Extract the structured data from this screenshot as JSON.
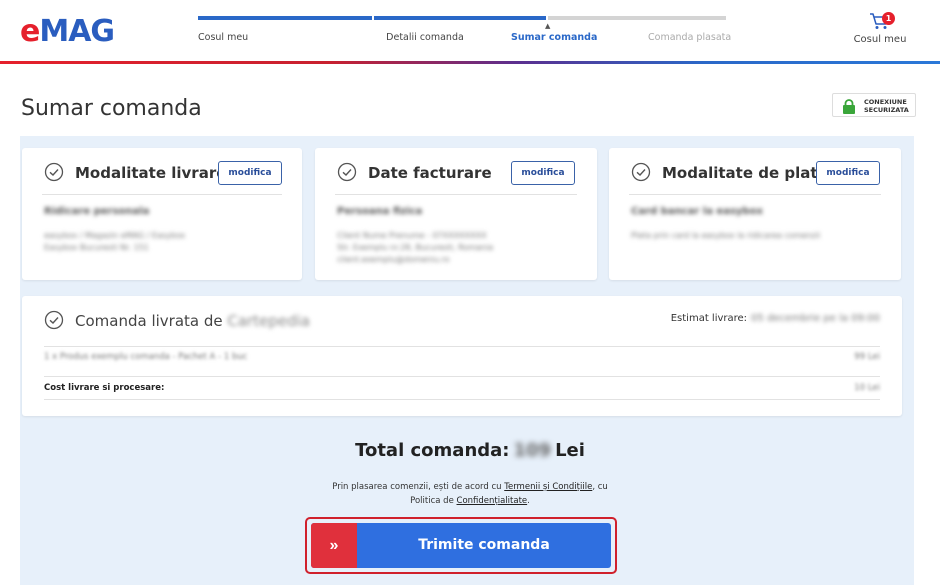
{
  "header": {
    "logo": {
      "e": "e",
      "mag": "MAG"
    },
    "steps": [
      {
        "label": "Cosul meu",
        "state": "done"
      },
      {
        "label": "Detalii comanda",
        "state": "done"
      },
      {
        "label": "Sumar comanda",
        "state": "active"
      },
      {
        "label": "Comanda plasata",
        "state": "todo"
      }
    ],
    "cart": {
      "label": "Cosul meu",
      "count": "1",
      "icon": "cart-icon"
    }
  },
  "page": {
    "title": "Sumar comanda",
    "secure_badge": {
      "line1": "CONEXIUNE",
      "line2": "SECURIZATA",
      "icon": "lock-icon"
    }
  },
  "cards": {
    "delivery_method": {
      "title": "Modalitate livrare",
      "button": "modifica",
      "line1": "Ridicare personala",
      "line2": "easybox / Magazin eMAG / Easybox",
      "line3": "Easybox Bucuresti Nr. 151"
    },
    "billing": {
      "title": "Date facturare",
      "button": "modifica",
      "line1": "Persoana fizica",
      "line2": "Client Nume Prenume - 07XXXXXXXX",
      "line3": "Str. Exemplu nr.28, Bucuresti, Romania",
      "line4": "client.exemplu@domeniu.ro"
    },
    "payment": {
      "title": "Modalitate de plata",
      "button": "modifica",
      "line1": "Card bancar la easybox",
      "line2": "Plata prin card la easybox la ridicarea comenzii"
    }
  },
  "delivery": {
    "title_prefix": "Comanda livrata de",
    "seller": "Cartepedia",
    "estimate_label": "Estimat livrare:",
    "estimate_value": "05 decembrie pe la 09:00",
    "product_line": "1 x Produs exemplu comanda - Pachet A - 1 buc",
    "product_price": "99 Lei",
    "shipping_label": "Cost livrare si procesare:",
    "shipping_price": "10 Lei"
  },
  "total": {
    "label": "Total comanda:",
    "value": "109",
    "currency": "Lei"
  },
  "terms": {
    "text_before": "Prin plasarea comenzii, ești de acord cu ",
    "terms_link": "Termenii și Condițiile",
    "text_middle": ", cu",
    "text_before2": "Politica de ",
    "privacy_link": "Confidențialitate",
    "text_after": "."
  },
  "submit": {
    "label": "Trimite comanda",
    "arrow": "»"
  },
  "colors": {
    "brand_red": "#e5202c",
    "brand_blue": "#2a68c8",
    "panel_bg": "#e7f0fa",
    "submit_blue": "#2f6fe0"
  }
}
